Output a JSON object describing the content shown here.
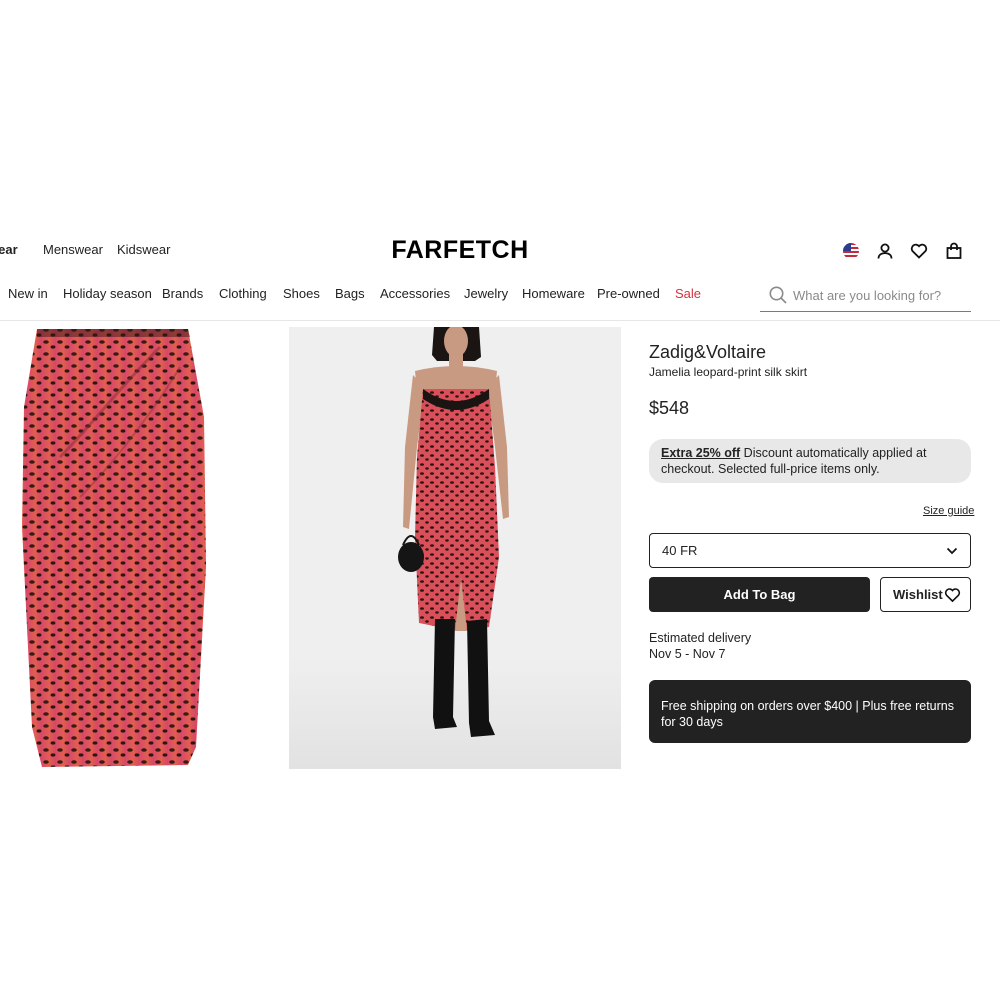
{
  "header": {
    "gender_tabs": [
      "wear",
      "Menswear",
      "Kidswear"
    ],
    "logo_text": "FARFETCH",
    "icons": [
      "us-flag-icon",
      "account-icon",
      "wishlist-heart-icon",
      "shopping-bag-icon"
    ]
  },
  "nav": {
    "categories": [
      "New in",
      "Holiday season",
      "Brands",
      "Clothing",
      "Shoes",
      "Bags",
      "Accessories",
      "Jewelry",
      "Homeware",
      "Pre-owned",
      "Sale"
    ],
    "sale_color": "#d5303e"
  },
  "search": {
    "placeholder": "What are you looking for?",
    "value": ""
  },
  "product": {
    "brand": "Zadig&Voltaire",
    "name": "Jamelia leopard-print silk skirt",
    "price": "$548",
    "promo_highlight": "Extra 25% off",
    "promo_text": " Discount automatically applied at checkout. Selected full-price items only.",
    "size_guide": "Size guide",
    "selected_size": "40 FR",
    "add_to_bag": "Add To Bag",
    "wishlist": "Wishlist",
    "delivery_label": "Estimated delivery",
    "delivery_dates": "Nov 5 - Nov 7",
    "shipping_banner": "Free shipping on orders over $400 | Plus free returns for 30 days"
  },
  "colors": {
    "accent_dark": "#222222",
    "promo_bg": "#e8e8e8",
    "image_bg": "#efefef"
  }
}
